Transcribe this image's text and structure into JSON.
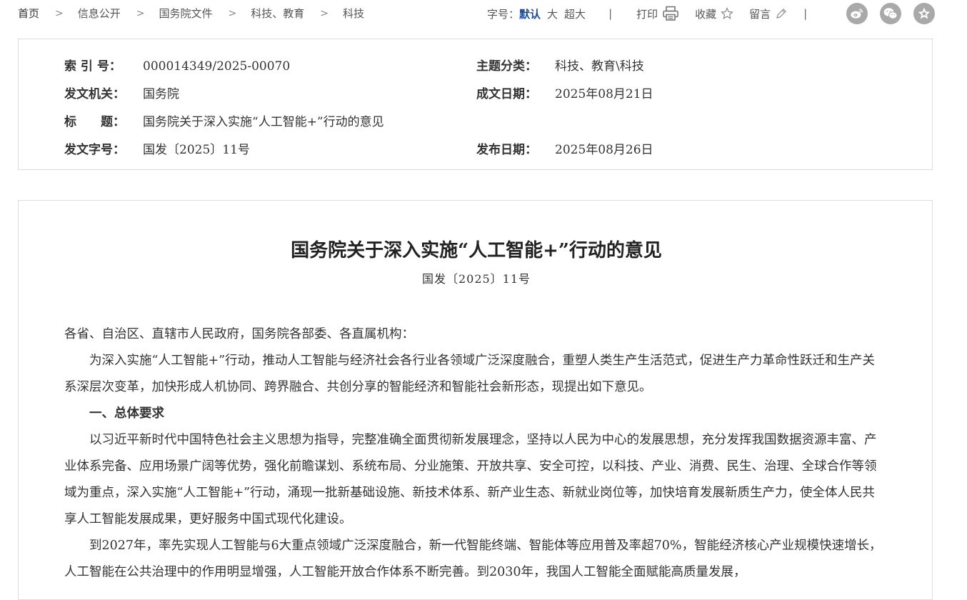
{
  "breadcrumb": {
    "items": [
      "首页",
      "信息公开",
      "国务院文件",
      "科技、教育",
      "科技"
    ],
    "separator": ">"
  },
  "toolbar": {
    "font_size_label": "字号：",
    "font_sizes": [
      "默认",
      "大",
      "超大"
    ],
    "divider": "|",
    "print_label": "打印",
    "favorite_label": "收藏",
    "comment_label": "留言"
  },
  "social": {
    "icons": [
      "weibo-icon",
      "wechat-icon",
      "star-emblem-icon"
    ],
    "color": "#a9a9a9"
  },
  "meta": {
    "index_no_label": "索 引 号：",
    "index_no": "000014349/2025-00070",
    "category_label": "主题分类：",
    "category": "科技、教育\\科技",
    "issuer_label": "发文机关：",
    "issuer": "国务院",
    "written_date_label": "成文日期：",
    "written_date": "2025年08月21日",
    "title_label": "标　　题：",
    "title": "国务院关于深入实施“人工智能+”行动的意见",
    "doc_no_label": "发文字号：",
    "doc_no": "国发〔2025〕11号",
    "publish_date_label": "发布日期：",
    "publish_date": "2025年08月26日"
  },
  "article": {
    "title": "国务院关于深入实施“人工智能+”行动的意见",
    "doc_number": "国发〔2025〕11号",
    "salutation": "各省、自治区、直辖市人民政府，国务院各部委、各直属机构：",
    "para1": "为深入实施“人工智能+”行动，推动人工智能与经济社会各行业各领域广泛深度融合，重塑人类生产生活范式，促进生产力革命性跃迁和生产关系深层次变革，加快形成人机协同、跨界融合、共创分享的智能经济和智能社会新形态，现提出如下意见。",
    "heading1": "一、总体要求",
    "para2": "以习近平新时代中国特色社会主义思想为指导，完整准确全面贯彻新发展理念，坚持以人民为中心的发展思想，充分发挥我国数据资源丰富、产业体系完备、应用场景广阔等优势，强化前瞻谋划、系统布局、分业施策、开放共享、安全可控，以科技、产业、消费、民生、治理、全球合作等领域为重点，深入实施“人工智能+”行动，涌现一批新基础设施、新技术体系、新产业生态、新就业岗位等，加快培育发展新质生产力，使全体人民共享人工智能发展成果，更好服务中国式现代化建设。",
    "para3": "到2027年，率先实现人工智能与6大重点领域广泛深度融合，新一代智能终端、智能体等应用普及率超70%，智能经济核心产业规模快速增长，人工智能在公共治理中的作用明显增强，人工智能开放合作体系不断完善。到2030年，我国人工智能全面赋能高质量发展，"
  },
  "colors": {
    "active_font_size": "#1d4b9e",
    "border": "#dcdcdc",
    "text": "#333333"
  }
}
